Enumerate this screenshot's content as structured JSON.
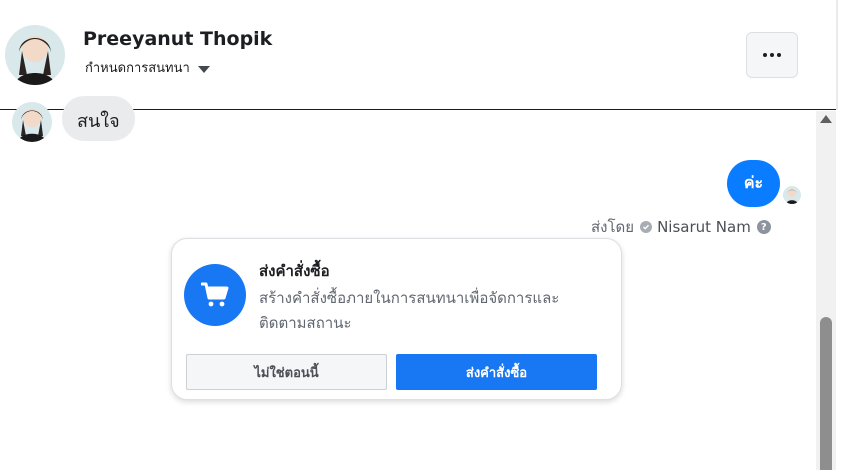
{
  "header": {
    "contact_name": "Preeyanut Thopik",
    "conversation_settings_label": "กำหนดการสนทนา",
    "more_icon": "more-horizontal-icon"
  },
  "messages": {
    "incoming_text": "สนใจ",
    "outgoing_text": "ค่ะ",
    "sent_by_prefix": "ส่งโดย",
    "sent_by_agent": "Nisarut Nam",
    "help_glyph": "?"
  },
  "order_card": {
    "icon": "shopping-cart-icon",
    "title": "ส่งคำสั่งซื้อ",
    "description": "สร้างคำสั่งซื้อภายในการสนทนาเพื่อจัดการและติดตามสถานะ",
    "secondary_button": "ไม่ใช่ตอนนี้",
    "primary_button": "ส่งคำสั่งซื้อ"
  },
  "colors": {
    "accent": "#1877f2",
    "outgoing_bubble": "#0a7cff",
    "incoming_bubble": "#eaebed"
  }
}
